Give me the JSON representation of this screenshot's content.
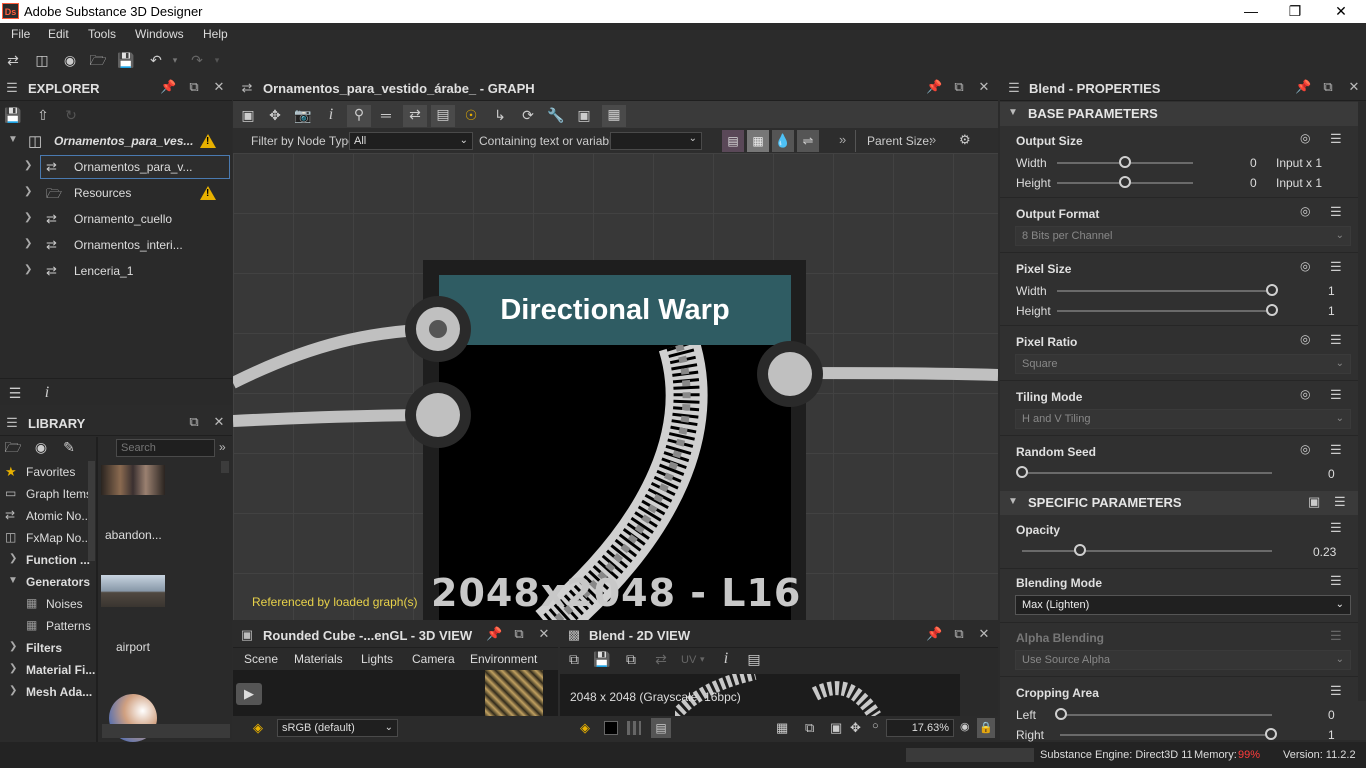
{
  "window": {
    "title": "Adobe Substance 3D Designer",
    "logo": "Ds"
  },
  "menu": [
    "File",
    "Edit",
    "Tools",
    "Windows",
    "Help"
  ],
  "explorer": {
    "title": "EXPLORER",
    "package": "Ornamentos_para_ves...",
    "items": [
      {
        "label": "Ornamentos_para_v...",
        "selected": true
      },
      {
        "label": "Resources",
        "warning": true
      },
      {
        "label": "Ornamento_cuello"
      },
      {
        "label": "Ornamentos_interi..."
      },
      {
        "label": "Lenceria_1"
      }
    ]
  },
  "library": {
    "title": "LIBRARY",
    "search_placeholder": "Search",
    "categories": [
      {
        "label": "Favorites",
        "icon": "star-icon"
      },
      {
        "label": "Graph Items"
      },
      {
        "label": "Atomic No..."
      },
      {
        "label": "FxMap No..."
      },
      {
        "label": "Function ..."
      },
      {
        "label": "Generators"
      },
      {
        "label": "Noises"
      },
      {
        "label": "Patterns"
      },
      {
        "label": "Filters"
      },
      {
        "label": "Material Fi..."
      },
      {
        "label": "Mesh Ada..."
      }
    ],
    "thumbs": [
      {
        "label": "abandon..."
      },
      {
        "label": "airport"
      }
    ]
  },
  "graph": {
    "title": "Ornamentos_para_vestido_árabe_ - GRAPH",
    "filter_label": "Filter by Node Type",
    "filter_value": "All",
    "containing_label": "Containing text or variable",
    "parent_size_label": "Parent Size:",
    "node_title": "Directional Warp",
    "node_info": "2048x2048 - L16",
    "referenced_note": "Referenced by loaded graph(s)"
  },
  "properties": {
    "title": "Blend - PROPERTIES",
    "base_section": "BASE PARAMETERS",
    "specific_section": "SPECIFIC PARAMETERS",
    "output_size": {
      "label": "Output Size",
      "width_label": "Width",
      "height_label": "Height",
      "width_value": "0",
      "height_value": "0",
      "width_mode": "Input x 1",
      "height_mode": "Input x 1",
      "slider": 0.5
    },
    "output_format": {
      "label": "Output Format",
      "value": "8 Bits per Channel"
    },
    "pixel_size": {
      "label": "Pixel Size",
      "width_label": "Width",
      "height_label": "Height",
      "width_value": "1",
      "height_value": "1",
      "slider": 1.0
    },
    "pixel_ratio": {
      "label": "Pixel Ratio",
      "value": "Square"
    },
    "tiling_mode": {
      "label": "Tiling Mode",
      "value": "H and V Tiling"
    },
    "random_seed": {
      "label": "Random Seed",
      "value": "0",
      "slider": 0.0
    },
    "opacity": {
      "label": "Opacity",
      "value": "0.23",
      "slider": 0.23
    },
    "blending_mode": {
      "label": "Blending Mode",
      "value": "Max (Lighten)"
    },
    "alpha_blending": {
      "label": "Alpha Blending",
      "value": "Use Source Alpha"
    },
    "cropping_area": {
      "label": "Cropping Area",
      "left_label": "Left",
      "right_label": "Right",
      "left_value": "0",
      "right_value": "1"
    }
  },
  "view3d": {
    "title": "Rounded Cube -...enGL - 3D VIEW",
    "tabs": [
      "Scene",
      "Materials",
      "Lights",
      "Camera",
      "Environment"
    ],
    "colorspace": "sRGB (default)"
  },
  "view2d": {
    "title": "Blend - 2D VIEW",
    "uv_label": "UV",
    "info": "2048 x 2048 (Grayscale, 16bpc)",
    "zoom": "17.63%"
  },
  "status": {
    "engine": "Substance Engine: Direct3D 11",
    "memory_label": "Memory:",
    "memory_value": "99%",
    "version": "Version: 11.2.2"
  },
  "colors": {
    "node_header": "#2f5c63",
    "accent_warning": "#e8b100",
    "memory_alert": "#ff3b3b"
  }
}
